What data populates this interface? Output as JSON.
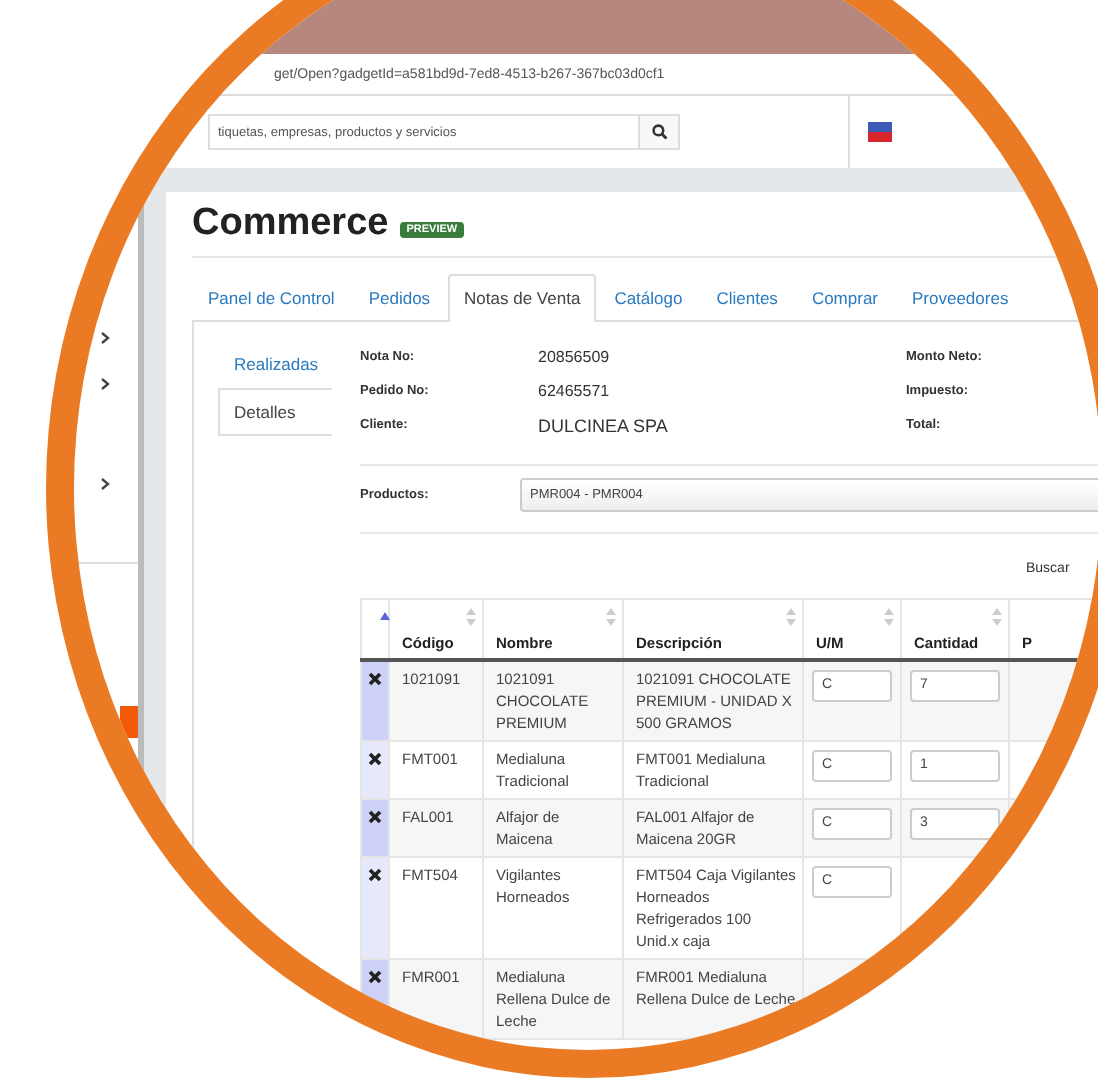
{
  "browser": {
    "url": "get/Open?gadgetId=a581bd9d-7ed8-4513-b267-367bc03d0cf1"
  },
  "header": {
    "search": {
      "placeholder": "tiquetas, empresas, productos y servicios"
    }
  },
  "page": {
    "title": "Commerce",
    "badge": "PREVIEW"
  },
  "tabs": [
    {
      "label": "Panel de Control",
      "selected": false
    },
    {
      "label": "Pedidos",
      "selected": false
    },
    {
      "label": "Notas de Venta",
      "selected": true
    },
    {
      "label": "Catálogo",
      "selected": false
    },
    {
      "label": "Clientes",
      "selected": false
    },
    {
      "label": "Comprar",
      "selected": false
    },
    {
      "label": "Proveedores",
      "selected": false
    }
  ],
  "side_tabs": [
    {
      "label": "Realizadas",
      "selected": false
    },
    {
      "label": "Detalles",
      "selected": true
    }
  ],
  "details": {
    "left": [
      {
        "label": "Nota No:",
        "value": "20856509"
      },
      {
        "label": "Pedido No:",
        "value": "62465571"
      },
      {
        "label": "Cliente:",
        "value": "DULCINEA SPA"
      }
    ],
    "right": [
      {
        "label": "Monto Neto:"
      },
      {
        "label": "Impuesto:"
      },
      {
        "label": "Total:"
      }
    ]
  },
  "productos": {
    "label": "Productos:",
    "value": "PMR004 - PMR004"
  },
  "search_label": "Buscar",
  "table": {
    "select_column": {
      "sorted": true
    },
    "columns": [
      {
        "label": "Código"
      },
      {
        "label": "Nombre"
      },
      {
        "label": "Descripción"
      },
      {
        "label": "U/M"
      },
      {
        "label": "Cantidad"
      },
      {
        "label": "P"
      }
    ],
    "rows": [
      {
        "code": "1021091",
        "name": "1021091 CHOCOLATE PREMIUM",
        "description": "1021091 CHOCOLATE PREMIUM - UNIDAD X 500 GRAMOS",
        "um": "C",
        "cantidad": "7"
      },
      {
        "code": "FMT001",
        "name": "Medialuna Tradicional",
        "description": "FMT001 Medialuna Tradicional",
        "um": "C",
        "cantidad": "1"
      },
      {
        "code": "FAL001",
        "name": "Alfajor de Maicena",
        "description": "FAL001 Alfajor de Maicena 20GR",
        "um": "C",
        "cantidad": "3"
      },
      {
        "code": "FMT504",
        "name": "Vigilantes Horneados",
        "description": "FMT504 Caja Vigilantes Horneados Refrigerados 100 Unid.x caja",
        "um": "C"
      },
      {
        "code": "FMR001",
        "name": "Medialuna Rellena Dulce de Leche",
        "description": "FMR001 Medialuna Rellena Dulce de Leche"
      }
    ]
  }
}
